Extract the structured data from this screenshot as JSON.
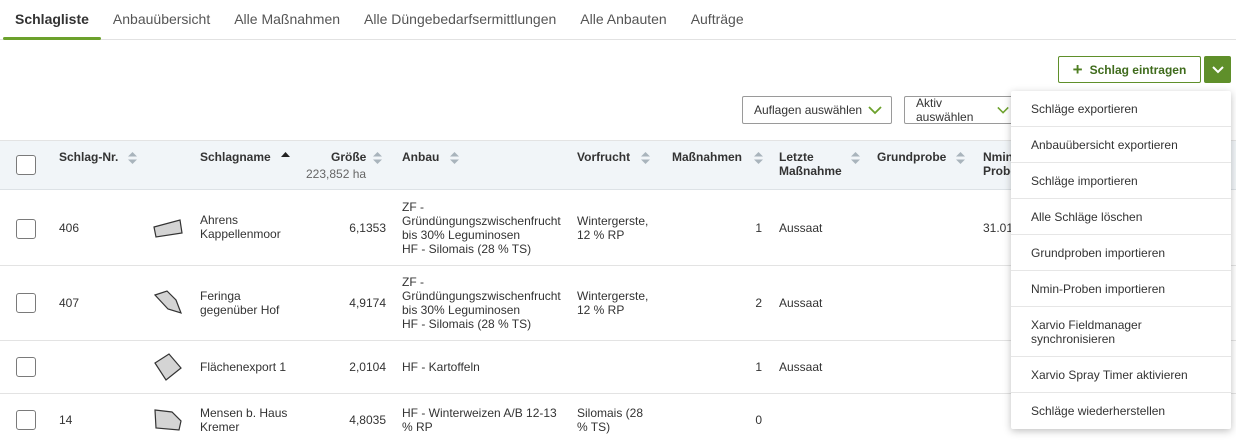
{
  "tabs": [
    {
      "label": "Schlagliste"
    },
    {
      "label": "Anbauübersicht"
    },
    {
      "label": "Alle Maßnahmen"
    },
    {
      "label": "Alle Düngebedarfsermittlungen"
    },
    {
      "label": "Alle Anbauten"
    },
    {
      "label": "Aufträge"
    }
  ],
  "toolbar": {
    "add_label": "Schlag eintragen"
  },
  "filters": {
    "auflagen": "Auflagen auswählen",
    "aktiv": "Aktiv auswählen"
  },
  "table": {
    "headers": {
      "nr": "Schlag-Nr.",
      "name": "Schlagname",
      "groesse": "Größe",
      "groesse_total": "223,852 ha",
      "anbau": "Anbau",
      "vorfrucht": "Vorfrucht",
      "massnahmen": "Maßnahmen",
      "letzte_1": "Letzte",
      "letzte_2": "Maßnahme",
      "grundprobe": "Grundprobe",
      "nmin_1": "Nmin",
      "nmin_2": "Probe"
    },
    "rows": [
      {
        "nr": "406",
        "name_1": "Ahrens",
        "name_2": "Kappellenmoor",
        "groesse": "6,1353",
        "anbau_1": "ZF -",
        "anbau_2": "Gründüngungszwischenfrucht",
        "anbau_3": "bis 30% Leguminosen",
        "anbau_4": "HF - Silomais (28 % TS)",
        "vorfrucht_1": "Wintergerste,",
        "vorfrucht_2": "12 % RP",
        "massnahmen": "1",
        "letzte": "Aussaat",
        "nmin": "31.01"
      },
      {
        "nr": "407",
        "name_1": "Feringa",
        "name_2": "gegenüber Hof",
        "groesse": "4,9174",
        "anbau_1": "ZF -",
        "anbau_2": "Gründüngungszwischenfrucht",
        "anbau_3": "bis 30% Leguminosen",
        "anbau_4": "HF - Silomais (28 % TS)",
        "vorfrucht_1": "Wintergerste,",
        "vorfrucht_2": "12 % RP",
        "massnahmen": "2",
        "letzte": "Aussaat",
        "nmin": ""
      },
      {
        "nr": "",
        "name_1": "Flächenexport 1",
        "name_2": "",
        "groesse": "2,0104",
        "anbau_1": "HF - Kartoffeln",
        "anbau_2": "",
        "anbau_3": "",
        "anbau_4": "",
        "vorfrucht_1": "",
        "vorfrucht_2": "",
        "massnahmen": "1",
        "letzte": "Aussaat",
        "nmin": ""
      },
      {
        "nr": "14",
        "name_1": "Mensen b. Haus",
        "name_2": "Kremer",
        "groesse": "4,8035",
        "anbau_1": "HF - Winterweizen A/B 12-13",
        "anbau_2": "% RP",
        "anbau_3": "",
        "anbau_4": "",
        "vorfrucht_1": "Silomais (28",
        "vorfrucht_2": "% TS)",
        "massnahmen": "0",
        "letzte": "",
        "nmin": ""
      }
    ]
  },
  "menu": {
    "items": [
      {
        "label": "Schläge exportieren"
      },
      {
        "label": "Anbauübersicht exportieren"
      },
      {
        "label": "Schläge importieren"
      },
      {
        "label": "Alle Schläge löschen"
      },
      {
        "label": "Grundproben importieren"
      },
      {
        "label": "Nmin-Proben importieren"
      },
      {
        "label_1": "Xarvio Fieldmanager",
        "label_2": "synchronisieren"
      },
      {
        "label": "Xarvio Spray Timer aktivieren"
      },
      {
        "label": "Schläge wiederherstellen"
      }
    ]
  },
  "colors": {
    "accent": "#6ca12c",
    "button_dark": "#5f8f2a",
    "header_bg": "#f1f5f8"
  }
}
